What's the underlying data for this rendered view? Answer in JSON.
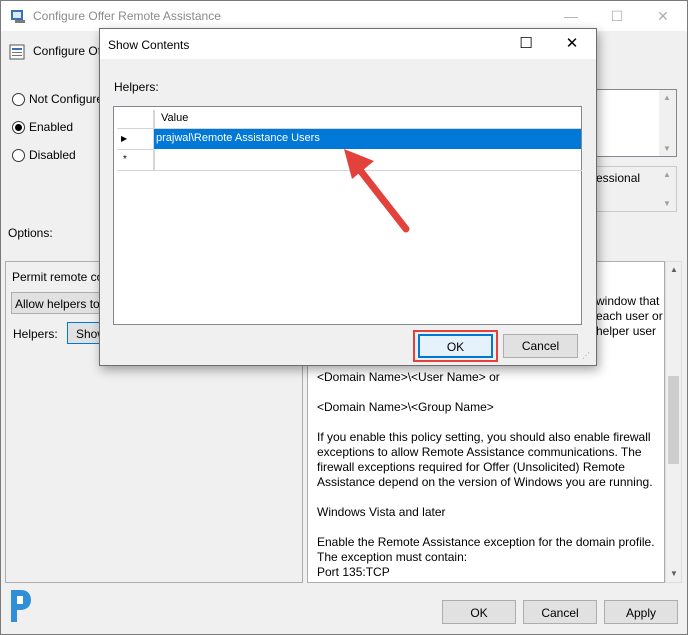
{
  "window": {
    "title": "Configure Offer Remote Assistance",
    "subtitle": "Configure Of",
    "minimize": "—",
    "maximize": "☐",
    "close": "✕"
  },
  "state": {
    "not_configured": "Not Configure",
    "enabled": "Enabled",
    "disabled": "Disabled"
  },
  "right_partial": {
    "text": "essional"
  },
  "options": {
    "label": "Options:",
    "permit": "Permit remote co",
    "dropdown": "Allow helpers to",
    "helpers_label": "Helpers:",
    "show_button": "Show"
  },
  "help_text": {
    "partial_top": [
      "window that",
      "each user or",
      "helper user"
    ],
    "lines": [
      "<Domain Name>\\<User Name> or",
      "<Domain Name>\\<Group Name>",
      "If you enable this policy setting, you should also enable firewall",
      "exceptions to allow Remote Assistance communications. The",
      "firewall exceptions required for Offer (Unsolicited) Remote",
      "Assistance depend on the version of Windows you are running.",
      "Windows Vista and later",
      "Enable the Remote Assistance exception for the domain profile.",
      "The exception must contain:",
      "Port 135:TCP"
    ]
  },
  "footer": {
    "ok": "OK",
    "cancel": "Cancel",
    "apply": "Apply"
  },
  "dialog": {
    "title": "Show Contents",
    "maximize": "☐",
    "close": "✕",
    "list_label": "Helpers:",
    "column_header": "Value",
    "rows": [
      {
        "marker": "▶",
        "value": "prajwal\\Remote Assistance Users"
      },
      {
        "marker": "*",
        "value": ""
      }
    ],
    "ok": "OK",
    "cancel": "Cancel"
  },
  "colors": {
    "selection": "#0078d7",
    "annotation_red": "#e3413c"
  }
}
